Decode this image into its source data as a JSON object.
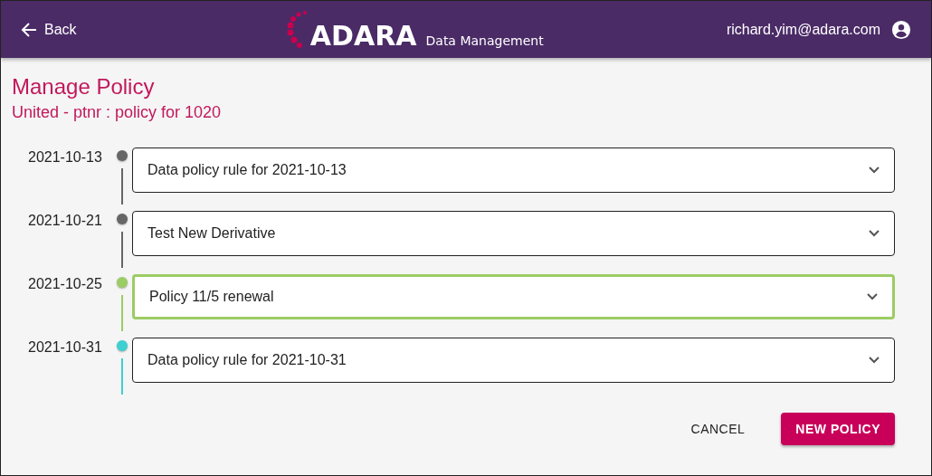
{
  "header": {
    "back_label": "Back",
    "logo": "ADARA",
    "subtitle": "Data Management",
    "user_email": "richard.yim@adara.com"
  },
  "page": {
    "title": "Manage Policy",
    "subtitle": "United - ptnr : policy for 1020"
  },
  "timeline": [
    {
      "date": "2021-10-13",
      "label": "Data policy rule for 2021-10-13",
      "color": "#666666",
      "selected": false
    },
    {
      "date": "2021-10-21",
      "label": "Test New Derivative",
      "color": "#666666",
      "selected": false
    },
    {
      "date": "2021-10-25",
      "label": "Policy 11/5 renewal",
      "color": "#9ccc65",
      "selected": true
    },
    {
      "date": "2021-10-31",
      "label": "Data policy rule for 2021-10-31",
      "color": "#3ecfd0",
      "selected": false
    }
  ],
  "buttons": [
    {
      "label": "CANCEL",
      "kind": "text"
    },
    {
      "label": "NEW POLICY",
      "kind": "primary"
    }
  ]
}
